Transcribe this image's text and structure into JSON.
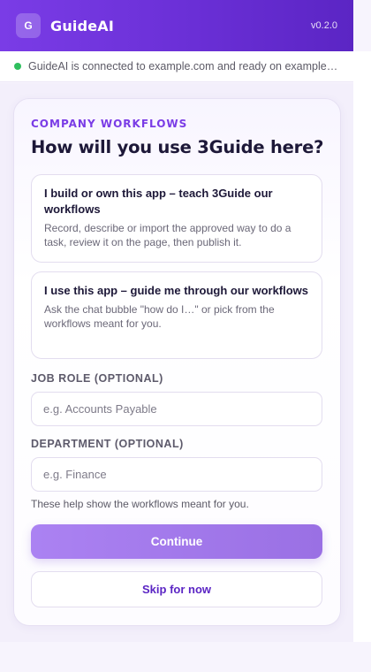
{
  "app": {
    "logo_letter": "G",
    "title": "GuideAI",
    "version": "v0.2.0"
  },
  "status": {
    "text": "GuideAI is connected to example.com and ready on example.com",
    "color": "#2fbf5e"
  },
  "onboarding": {
    "eyebrow": "COMPANY WORKFLOWS",
    "heading": "How will you use 3Guide here?",
    "options": [
      {
        "title": "I build or own this app – teach 3Guide our workflows",
        "description": "Record, describe or import the approved way to do a task, review it on the page, then publish it."
      },
      {
        "title": "I use this app – guide me through our workflows",
        "description": "Ask the chat bubble \"how do I…\" or pick from the workflows meant for you."
      }
    ],
    "job_role": {
      "label": "JOB ROLE (OPTIONAL)",
      "placeholder": "e.g. Accounts Payable",
      "value": ""
    },
    "department": {
      "label": "DEPARTMENT (OPTIONAL)",
      "placeholder": "e.g. Finance",
      "value": ""
    },
    "help_text": "These help show the workflows meant for you.",
    "continue_label": "Continue",
    "skip_label": "Skip for now"
  },
  "colors": {
    "accent": "#7a3ce6",
    "brand_dark": "#5b25c4",
    "button_primary": "#a37bee"
  }
}
